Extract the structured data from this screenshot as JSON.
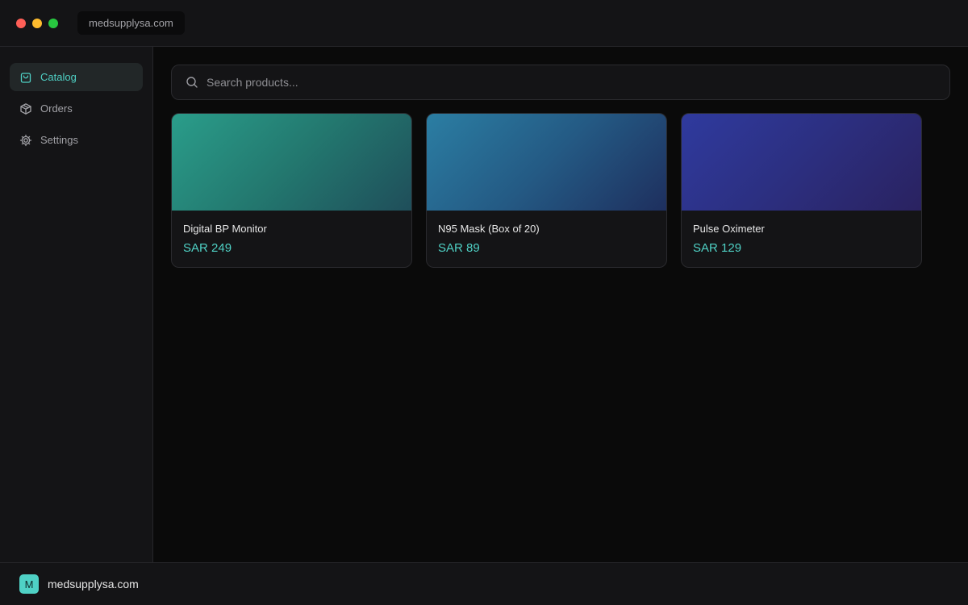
{
  "window": {
    "url": "medsupplysa.com"
  },
  "sidebar": {
    "items": [
      {
        "label": "Catalog",
        "icon": "shopping-bag-icon",
        "active": true
      },
      {
        "label": "Orders",
        "icon": "package-icon",
        "active": false
      },
      {
        "label": "Settings",
        "icon": "gear-icon",
        "active": false
      }
    ]
  },
  "search": {
    "placeholder": "Search products...",
    "value": ""
  },
  "products": [
    {
      "name": "Digital BP Monitor",
      "price": "SAR 249",
      "gradient": [
        "#2a9d8a",
        "#1f4e5a"
      ]
    },
    {
      "name": "N95 Mask (Box of 20)",
      "price": "SAR 89",
      "gradient": [
        "#2b7ea3",
        "#1e2f5e"
      ]
    },
    {
      "name": "Pulse Oximeter",
      "price": "SAR 129",
      "gradient": [
        "#2f3a9e",
        "#2a2260"
      ]
    }
  ],
  "footer": {
    "logo_letter": "M",
    "name": "medsupplysa.com"
  },
  "colors": {
    "accent": "#4fd1c5",
    "background": "#0a0a0a",
    "panel": "#141416"
  }
}
